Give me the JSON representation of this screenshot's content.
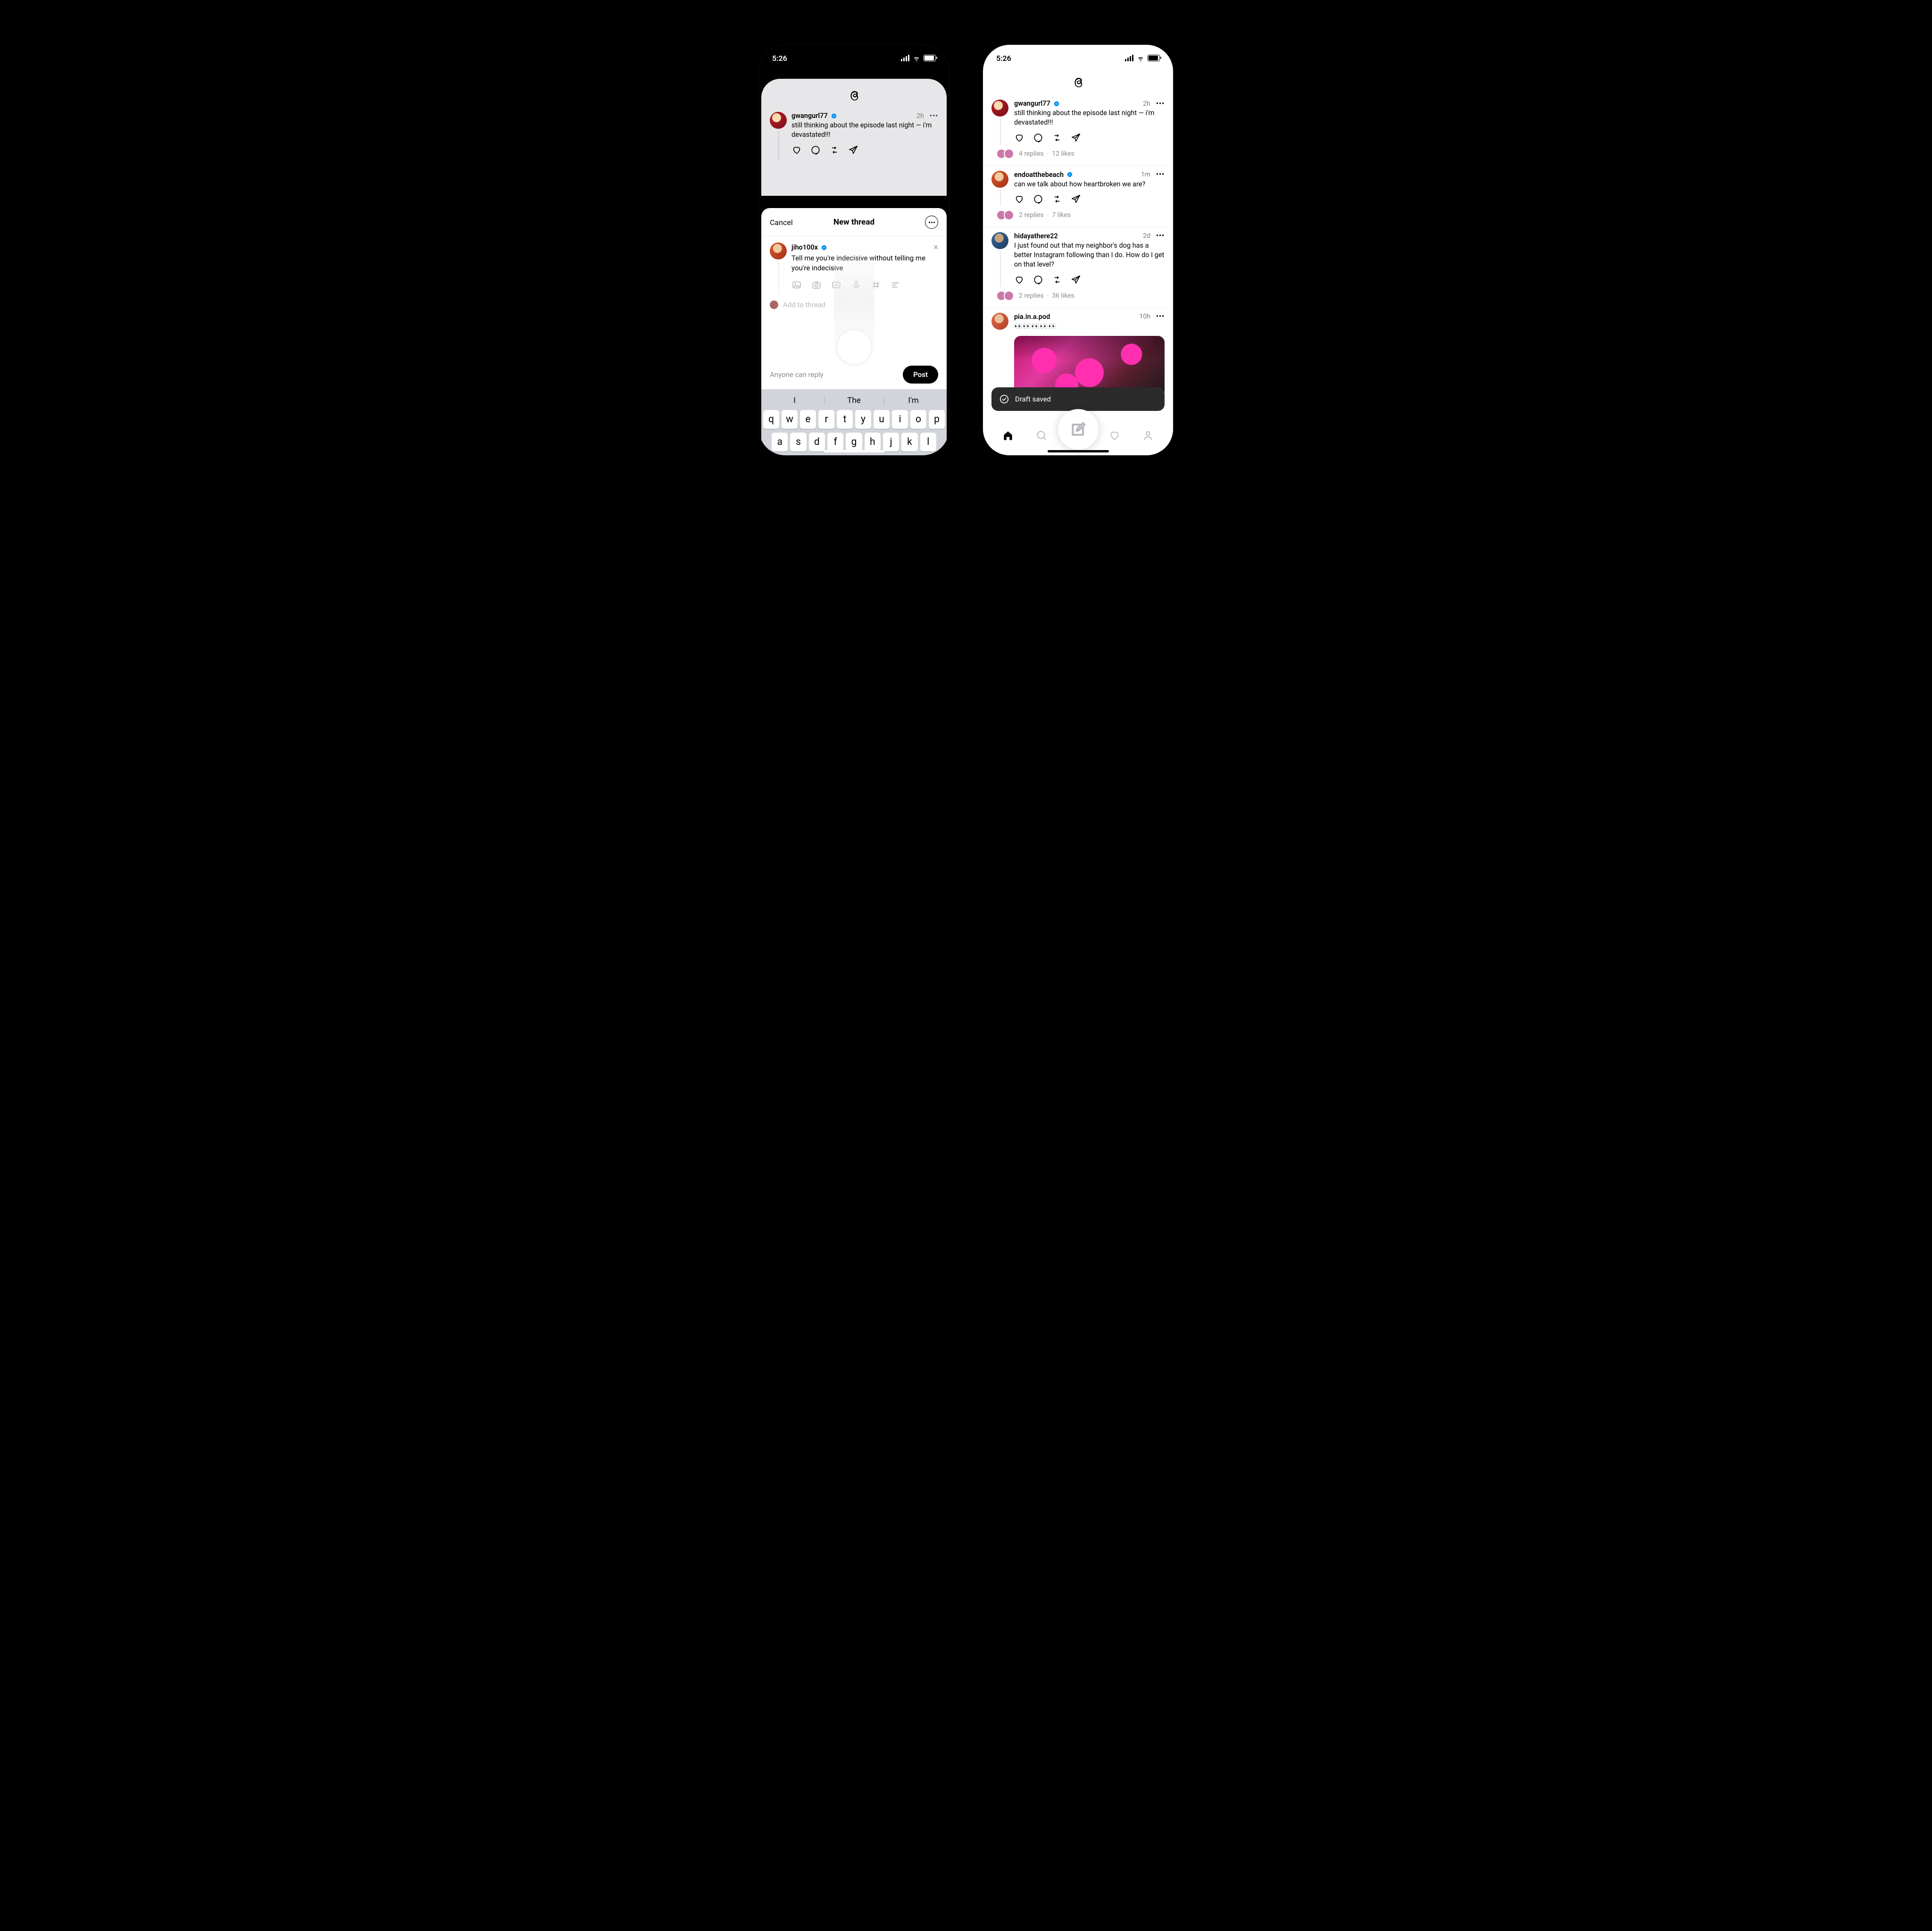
{
  "statusbar": {
    "time": "5:26"
  },
  "app": {
    "name": "Threads"
  },
  "phoneA": {
    "feed_post": {
      "username": "gwangurl77",
      "verified": true,
      "time": "2h",
      "text": "still thinking about the episode last night — i'm devastated!!!"
    },
    "sheet": {
      "cancel": "Cancel",
      "title": "New thread",
      "composer": {
        "username": "jiho100x",
        "verified": true,
        "text": "Tell me you're indecisive without telling me you're indecisive",
        "add_placeholder": "Add to thread"
      },
      "reply_scope": "Anyone can reply",
      "post_label": "Post"
    },
    "keyboard": {
      "suggestions": [
        "I",
        "The",
        "I'm"
      ],
      "row1": [
        "q",
        "w",
        "e",
        "r",
        "t",
        "y",
        "u",
        "i",
        "o",
        "p"
      ],
      "row2": [
        "a",
        "s",
        "d",
        "f",
        "g",
        "h",
        "j",
        "k",
        "l"
      ]
    }
  },
  "phoneB": {
    "posts": [
      {
        "username": "gwangurl77",
        "verified": true,
        "time": "2h",
        "text": "still thinking about the episode last night — i'm devastated!!!",
        "replies": "4 replies",
        "likes": "12 likes",
        "avatar": "av-red"
      },
      {
        "username": "endoatthebeach",
        "verified": true,
        "time": "1m",
        "text": "can we talk about how heartbroken we are?",
        "replies": "2 replies",
        "likes": "7 likes",
        "avatar": "av-orange"
      },
      {
        "username": "hidayathere22",
        "verified": false,
        "time": "2d",
        "text": "I just found out that my neighbor's dog has a better Instagram following than I do. How do I get on that level?",
        "replies": "2 replies",
        "likes": "36 likes",
        "avatar": "av-blue"
      },
      {
        "username": "pia.in.a.pod",
        "verified": false,
        "time": "10h",
        "text": "👀👀👀👀👀",
        "replies": "",
        "likes": "",
        "avatar": "av-coral",
        "image": true
      }
    ],
    "toast": "Draft saved"
  }
}
